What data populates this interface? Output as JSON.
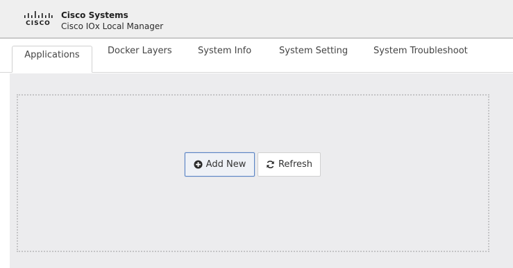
{
  "header": {
    "logo_text": "CISCO",
    "company": "Cisco Systems",
    "product": "Cisco IOx Local Manager"
  },
  "tabs": [
    {
      "label": "Applications",
      "active": true
    },
    {
      "label": "Docker Layers",
      "active": false
    },
    {
      "label": "System Info",
      "active": false
    },
    {
      "label": "System Setting",
      "active": false
    },
    {
      "label": "System Troubleshoot",
      "active": false
    }
  ],
  "actions": {
    "add_new": {
      "label": "Add New",
      "icon": "plus-circle-icon"
    },
    "refresh": {
      "label": "Refresh",
      "icon": "refresh-icon"
    }
  },
  "colors": {
    "header_bg": "#efefef",
    "content_bg": "#ececee",
    "add_button_border": "#5a83c5"
  }
}
